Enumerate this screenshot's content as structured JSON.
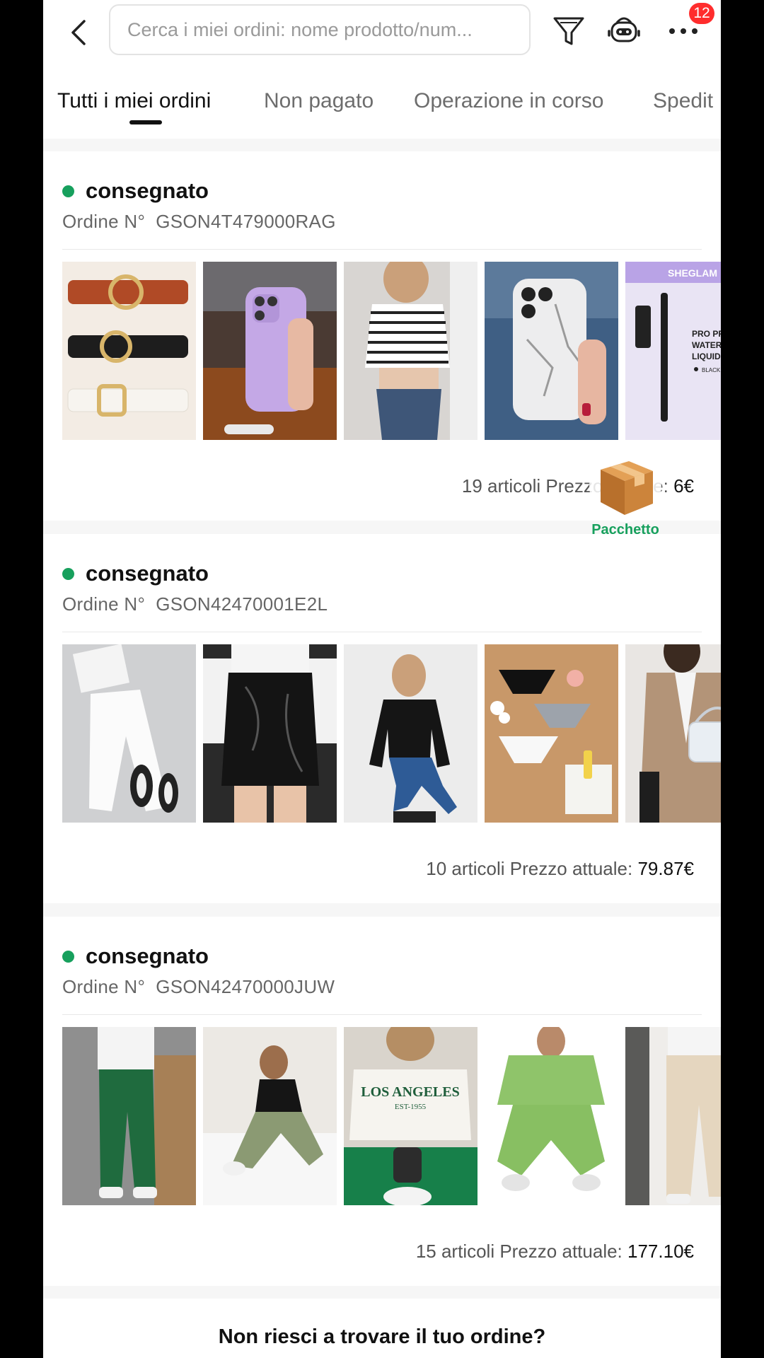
{
  "header": {
    "search_placeholder": "Cerca i miei ordini: nome prodotto/num...",
    "notification_count": "12"
  },
  "tabs": [
    {
      "label": "Tutti i miei ordini",
      "active": true
    },
    {
      "label": "Non pagato",
      "active": false
    },
    {
      "label": "Operazione in corso",
      "active": false
    },
    {
      "label": "Spedit",
      "active": false
    }
  ],
  "orders": [
    {
      "status": "consegnato",
      "order_prefix": "Ordine N°",
      "order_number": "GSON4T479000RAG",
      "items_text": "19 articoli",
      "price_label": "Prezzo attuale:",
      "price": "6€",
      "thumbnails": [
        "belts",
        "purple-phone-case",
        "striped-top",
        "marble-phone-case",
        "sheglam-eyeliner"
      ],
      "thumbnail_texts": [
        "SHEGLAM",
        "PRO PR",
        "WATERF",
        "LIQUID",
        "BLACK"
      ]
    },
    {
      "status": "consegnato",
      "order_prefix": "Ordine N°",
      "order_number": "GSON42470001E2L",
      "items_text": "10 articoli",
      "price_label": "Prezzo attuale:",
      "price": "79.87€",
      "thumbnails": [
        "white-joggers",
        "leather-skirt",
        "black-top-jeans",
        "underwear-set",
        "beige-blazer"
      ]
    },
    {
      "status": "consegnato",
      "order_prefix": "Ordine N°",
      "order_number": "GSON42470000JUW",
      "items_text": "15 articoli",
      "price_label": "Prezzo attuale:",
      "price": "177.10€",
      "thumbnails": [
        "green-sweatpants",
        "green-flares",
        "los-angeles-sweatshirt",
        "green-tracksuit",
        "cream-pants"
      ],
      "thumbnail_texts": [
        "LOS ANGELES",
        "EST-1955"
      ]
    }
  ],
  "package_widget": {
    "label": "Pacchetto"
  },
  "footer": {
    "question": "Non riesci a trovare il tuo ordine?"
  },
  "colors": {
    "status_green": "#17a05d",
    "badge_red": "#ff2d2d"
  }
}
